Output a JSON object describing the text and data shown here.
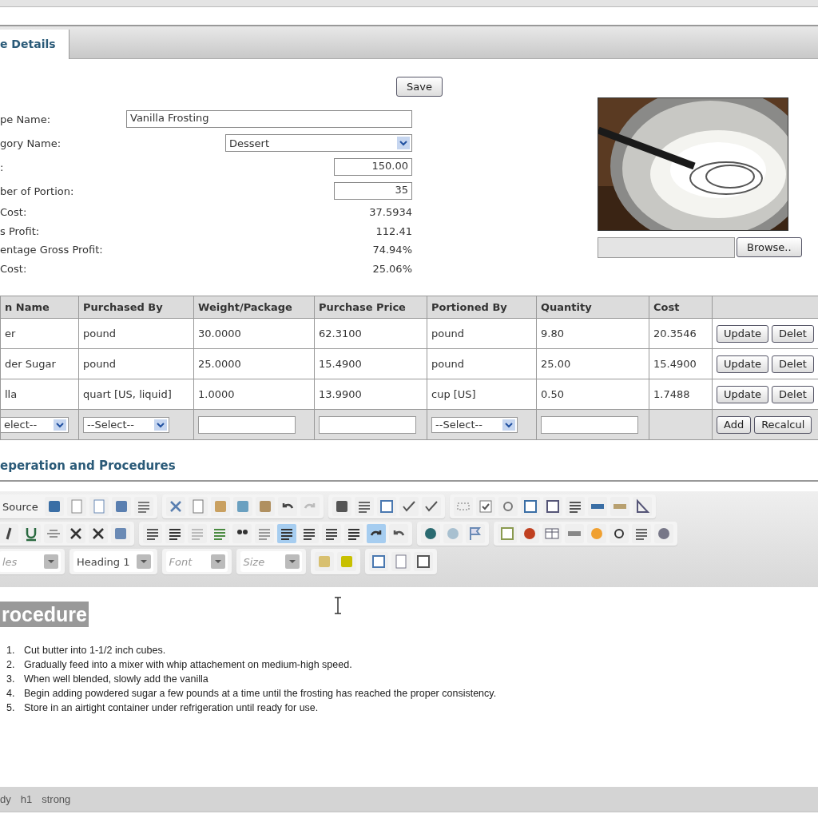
{
  "tabs": [
    {
      "label": "e Details",
      "selected": true
    }
  ],
  "form": {
    "save_button": "Save",
    "fields": [
      {
        "label": "pe Name:",
        "kind": "text",
        "value": "Vanilla Frosting"
      },
      {
        "label": "gory Name:",
        "kind": "select",
        "value": "Dessert"
      },
      {
        "label": ":",
        "kind": "number",
        "value": "150.00"
      },
      {
        "label": "ber of Portion:",
        "kind": "number",
        "value": "35"
      },
      {
        "label": "Cost:",
        "kind": "readout",
        "value": "37.5934"
      },
      {
        "label": "s Profit:",
        "kind": "readout",
        "value": "112.41"
      },
      {
        "label": "entage Gross Profit:",
        "kind": "readout",
        "value": "74.94%"
      },
      {
        "label": "Cost:",
        "kind": "readout",
        "value": "25.06%"
      }
    ],
    "browse_button": "Browse.."
  },
  "table": {
    "columns": [
      "n Name",
      "Purchased By",
      "Weight/Package",
      "Purchase Price",
      "Portioned By",
      "Quantity",
      "Cost"
    ],
    "rows": [
      {
        "cells": [
          "er",
          "pound",
          "30.0000",
          "62.3100",
          "pound",
          "9.80",
          "20.3546"
        ],
        "buttons": [
          "Update",
          "Delet"
        ]
      },
      {
        "cells": [
          "der Sugar",
          "pound",
          "25.0000",
          "15.4900",
          "pound",
          "25.00",
          "15.4900"
        ],
        "buttons": [
          "Update",
          "Delet"
        ]
      },
      {
        "cells": [
          "lla",
          "quart [US, liquid]",
          "1.0000",
          "13.9900",
          "cup [US]",
          "0.50",
          "1.7488"
        ],
        "buttons": [
          "Update",
          "Delet"
        ]
      }
    ],
    "new_row": {
      "cells": [
        {
          "kind": "select",
          "value": "elect--"
        },
        {
          "kind": "select",
          "value": "--Select--"
        },
        {
          "kind": "input"
        },
        {
          "kind": "input"
        },
        {
          "kind": "select",
          "value": "--Select--"
        },
        {
          "kind": "input"
        },
        {
          "kind": "empty"
        }
      ],
      "buttons": [
        "Add",
        "Recalcul"
      ]
    }
  },
  "section_title": "eperation and Procedures",
  "editor": {
    "toolbar": [
      [
        [
          {
            "kind": "source",
            "label": "Source"
          },
          {
            "kind": "icon",
            "selected": false
          },
          {
            "kind": "icon",
            "selected": false
          },
          {
            "kind": "icon",
            "selected": false
          },
          {
            "kind": "icon",
            "selected": false
          },
          {
            "kind": "icon",
            "selected": false
          }
        ],
        [
          {
            "kind": "icon",
            "selected": false
          },
          {
            "kind": "icon",
            "selected": false
          },
          {
            "kind": "icon",
            "selected": false
          },
          {
            "kind": "icon",
            "selected": false
          },
          {
            "kind": "icon",
            "selected": false
          },
          {
            "kind": "icon",
            "selected": false
          },
          {
            "kind": "icon",
            "selected": false
          }
        ],
        [
          {
            "kind": "icon",
            "selected": false
          },
          {
            "kind": "icon",
            "selected": false
          },
          {
            "kind": "icon",
            "selected": false
          },
          {
            "kind": "icon",
            "selected": false
          },
          {
            "kind": "icon",
            "selected": false
          }
        ],
        [
          {
            "kind": "icon",
            "selected": false
          },
          {
            "kind": "icon",
            "selected": false
          },
          {
            "kind": "icon",
            "selected": false
          },
          {
            "kind": "icon",
            "selected": false
          },
          {
            "kind": "icon",
            "selected": false
          },
          {
            "kind": "icon",
            "selected": false
          },
          {
            "kind": "icon",
            "selected": false
          },
          {
            "kind": "icon",
            "selected": false
          },
          {
            "kind": "icon",
            "selected": false
          }
        ]
      ],
      [
        [
          {
            "kind": "icon",
            "selected": false
          },
          {
            "kind": "icon",
            "selected": false
          },
          {
            "kind": "icon",
            "selected": false
          },
          {
            "kind": "icon",
            "selected": false
          },
          {
            "kind": "icon",
            "selected": false
          },
          {
            "kind": "icon",
            "selected": false
          }
        ],
        [
          {
            "kind": "icon",
            "selected": false
          },
          {
            "kind": "icon",
            "selected": false
          },
          {
            "kind": "icon",
            "selected": false
          },
          {
            "kind": "icon",
            "selected": false
          },
          {
            "kind": "icon",
            "selected": false
          },
          {
            "kind": "icon",
            "selected": false
          },
          {
            "kind": "icon",
            "selected": true
          },
          {
            "kind": "icon",
            "selected": false
          },
          {
            "kind": "icon",
            "selected": false
          },
          {
            "kind": "icon",
            "selected": false
          },
          {
            "kind": "icon",
            "selected": true
          },
          {
            "kind": "icon",
            "selected": false
          }
        ],
        [
          {
            "kind": "icon",
            "selected": false
          },
          {
            "kind": "icon",
            "selected": false
          },
          {
            "kind": "icon",
            "selected": false
          }
        ],
        [
          {
            "kind": "icon",
            "selected": false
          },
          {
            "kind": "icon",
            "selected": false
          },
          {
            "kind": "icon",
            "selected": false
          },
          {
            "kind": "icon",
            "selected": false
          },
          {
            "kind": "icon",
            "selected": false
          },
          {
            "kind": "icon",
            "selected": false
          },
          {
            "kind": "icon",
            "selected": false
          },
          {
            "kind": "icon",
            "selected": false
          }
        ]
      ],
      [
        [
          {
            "kind": "combo",
            "placeholder": "les"
          }
        ],
        [
          {
            "kind": "combo",
            "value": "Heading 1"
          }
        ],
        [
          {
            "kind": "combo",
            "placeholder": "Font"
          }
        ],
        [
          {
            "kind": "combo",
            "placeholder": "Size"
          }
        ],
        [
          {
            "kind": "icon",
            "selected": false
          },
          {
            "kind": "icon",
            "selected": false
          }
        ],
        [
          {
            "kind": "icon",
            "selected": false
          },
          {
            "kind": "icon",
            "selected": false
          },
          {
            "kind": "icon",
            "selected": false
          }
        ]
      ]
    ],
    "heading": "rocedure",
    "steps": [
      {
        "number": "1.",
        "text": "Cut butter into 1-1/2 inch cubes."
      },
      {
        "number": "2.",
        "text": "Gradually feed into a mixer with whip attachement on medium-high speed."
      },
      {
        "number": "3.",
        "text": "When well blended, slowly add the vanilla"
      },
      {
        "number": "4.",
        "text": "Begin adding powdered sugar a few pounds at a time until the frosting has reached the proper consistency."
      },
      {
        "number": "5.",
        "text": "Store in an airtight container under refrigeration until ready for use."
      }
    ],
    "path": [
      "dy",
      "h1",
      "strong"
    ]
  }
}
